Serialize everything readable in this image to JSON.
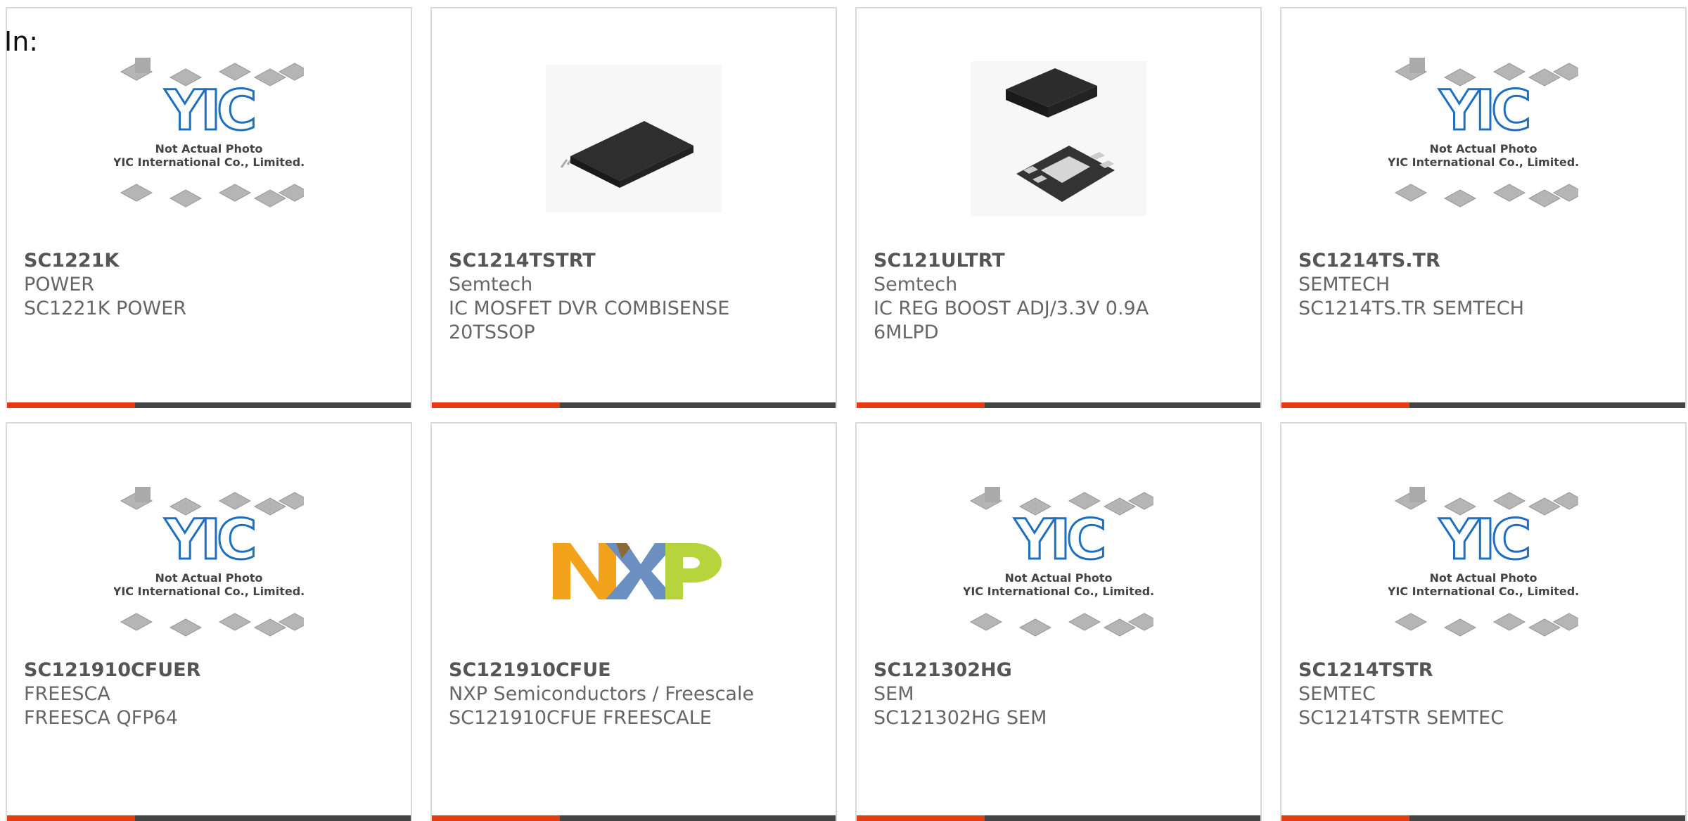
{
  "header": {
    "label": "In:"
  },
  "placeholder": {
    "brand": "YIC",
    "line1": "Not Actual Photo",
    "line2": "YIC International Co., Limited."
  },
  "nxp_logo": "NXP",
  "colors": {
    "accent": "#e63c12",
    "bar": "#444444",
    "border": "#d9d9d9",
    "yic_blue": "#1e6fc0"
  },
  "products": [
    {
      "part": "SC1221K",
      "mfr": "POWER",
      "desc": "SC1221K POWER",
      "image": "placeholder"
    },
    {
      "part": "SC1214TSTRT",
      "mfr": "Semtech",
      "desc": "IC MOSFET DVR COMBISENSE 20TSSOP",
      "image": "tssop-chip"
    },
    {
      "part": "SC121ULTRT",
      "mfr": "Semtech",
      "desc": "IC REG BOOST ADJ/3.3V 0.9A 6MLPD",
      "image": "mlpd-chip"
    },
    {
      "part": "SC1214TS.TR",
      "mfr": "SEMTECH",
      "desc": "SC1214TS.TR SEMTECH",
      "image": "placeholder"
    },
    {
      "part": "SC121910CFUER",
      "mfr": "FREESCA",
      "desc": "FREESCA QFP64",
      "image": "placeholder"
    },
    {
      "part": "SC121910CFUE",
      "mfr": "NXP Semiconductors / Freescale",
      "desc": "SC121910CFUE FREESCALE",
      "image": "nxp-logo"
    },
    {
      "part": "SC121302HG",
      "mfr": "SEM",
      "desc": "SC121302HG SEM",
      "image": "placeholder"
    },
    {
      "part": "SC1214TSTR",
      "mfr": "SEMTEC",
      "desc": "SC1214TSTR SEMTEC",
      "image": "placeholder"
    }
  ]
}
